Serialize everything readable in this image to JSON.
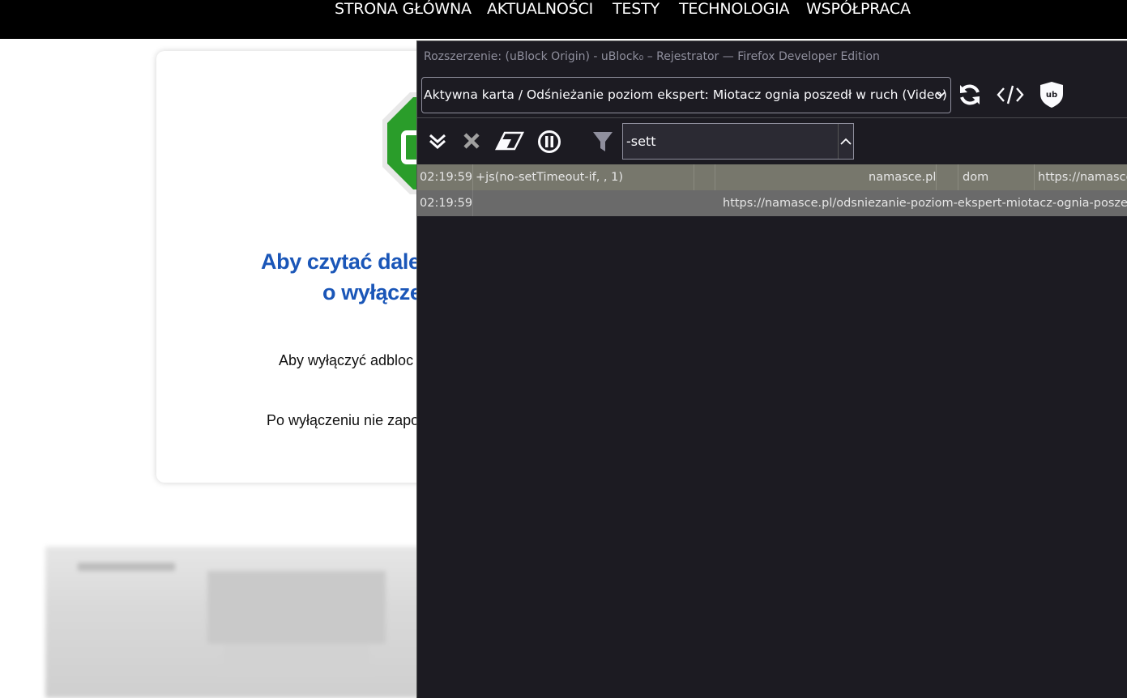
{
  "site_nav": {
    "items": [
      "STRONA GŁÓWNA",
      "AKTUALNOŚCI",
      "TESTY",
      "TECHNOLOGIA",
      "WSPÓŁPRACA"
    ]
  },
  "card": {
    "heading_line1": "Aby czytać dale",
    "heading_line2": "o wyłącze",
    "text1": "Aby wyłączyć adbloc",
    "text2": "Po wyłączeniu nie zapo",
    "accent_color": "#1a56b8",
    "stop_sign_color": "#2a9d2a"
  },
  "logger": {
    "window_title": "Rozszerzenie: (uBlock Origin) - uBlock₀ – Rejestrator — Firefox Developer Edition",
    "tab_selector_value": "Aktywna karta / Odśnieżanie poziom ekspert: Miotacz ognia poszedł w ruch (Video) -",
    "toolbar_icons": [
      "reload-icon",
      "dom-inspector-icon",
      "ublock-logo-icon"
    ],
    "filter_icons": [
      "collapse-icon",
      "close-icon",
      "eraser-icon",
      "pause-icon",
      "filter-icon"
    ],
    "filter_value": "-sett",
    "rows": [
      {
        "time": "02:19:59",
        "filter": "+js(no-setTimeout-if, , 1)",
        "context": "namasce.pl",
        "type": "dom",
        "url": "https://namasce"
      },
      {
        "time": "02:19:59",
        "filter": "",
        "context": "",
        "type": "",
        "url": "https://namasce.pl/odsniezanie-poziom-ekspert-miotacz-ognia-posze"
      }
    ]
  }
}
